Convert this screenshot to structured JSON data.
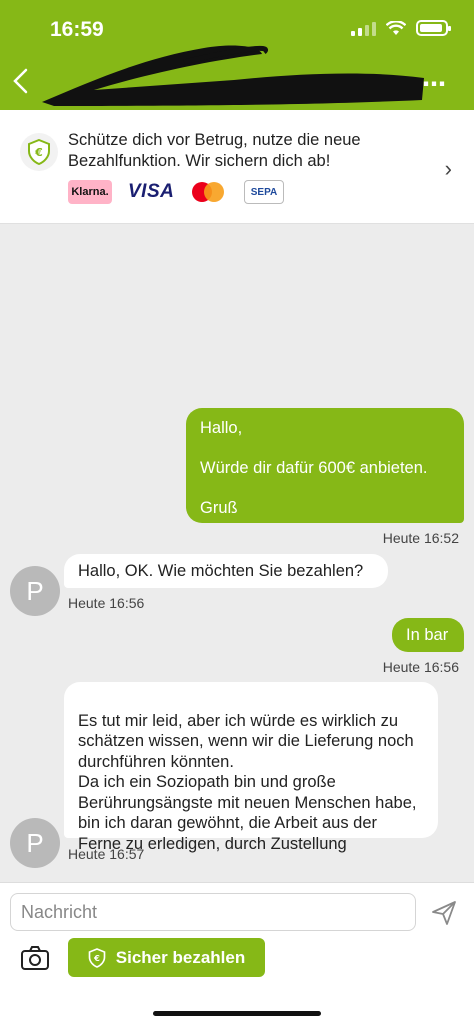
{
  "status": {
    "time": "16:59"
  },
  "colors": {
    "accent": "#86b817",
    "chat_bg": "#ececec",
    "bubble_in": "#ffffff"
  },
  "header": {
    "back_icon": "chevron-left-icon",
    "more_icon": "more-dots-icon"
  },
  "banner": {
    "text": "Schütze dich vor Betrug, nutze die neue Bezahlfunktion. Wir sichern dich ab!",
    "logos": {
      "klarna": "Klarna.",
      "visa": "VISA",
      "sepa": "SEPA"
    }
  },
  "messages": {
    "m1": {
      "line1": "Hallo,",
      "line2": "Würde dir dafür 600€ anbieten.",
      "line3": "Gruß",
      "time": "Heute 16:52"
    },
    "m2": {
      "text": "Hallo, OK. Wie möchten Sie bezahlen?",
      "time": "Heute 16:56",
      "avatar": "P"
    },
    "m3": {
      "text": "In bar",
      "time": "Heute 16:56"
    },
    "m4": {
      "text": "Es tut mir leid, aber ich würde es wirklich zu schätzen wissen, wenn wir die Lieferung noch durchführen könnten.\nDa ich ein Soziopath bin und große Berührungsängste mit neuen Menschen habe, bin ich daran gewöhnt, die Arbeit aus der Ferne zu erledigen, durch Zustellung",
      "time": "Heute 16:57",
      "avatar": "P"
    }
  },
  "composer": {
    "placeholder": "Nachricht",
    "pay_button": "Sicher bezahlen"
  }
}
